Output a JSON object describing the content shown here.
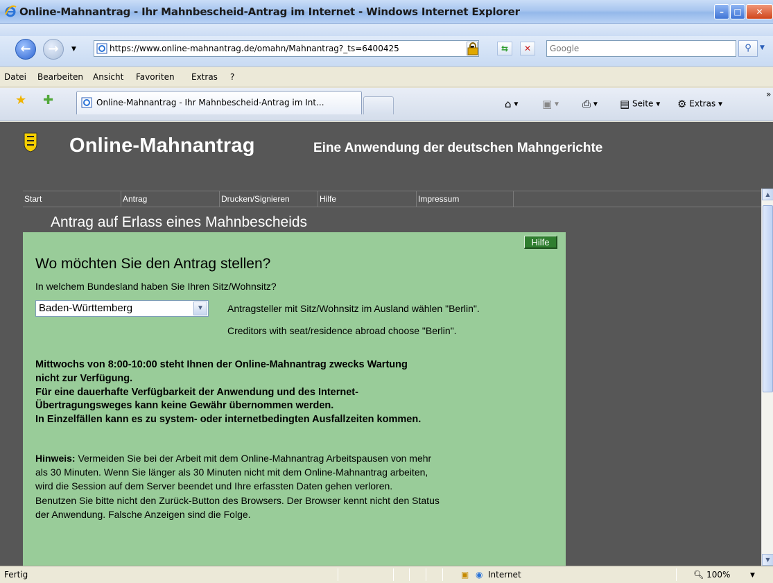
{
  "window": {
    "title": "Online-Mahnantrag - Ihr Mahnbescheid-Antrag im Internet - Windows Internet Explorer"
  },
  "address_bar": {
    "url": "https://www.online-mahnantrag.de/omahn/Mahnantrag?_ts=6400425",
    "search_placeholder": "Google"
  },
  "menu": {
    "items": [
      "Datei",
      "Bearbeiten",
      "Ansicht",
      "Favoriten",
      "Extras",
      "?"
    ]
  },
  "tabbar": {
    "tab_title": "Online-Mahnantrag - Ihr Mahnbescheid-Antrag im Int...",
    "page_label": "Seite",
    "extras_label": "Extras"
  },
  "site": {
    "brand": "Online-Mahnantrag",
    "slogan": "Eine Anwendung der deutschen Mahngerichte",
    "nav": [
      "Start",
      "Antrag",
      "Drucken/Signieren",
      "Hilfe",
      "Impressum"
    ],
    "page_heading": "Antrag auf Erlass eines Mahnbescheids"
  },
  "form": {
    "help_label": "Hilfe",
    "heading": "Wo möchten Sie den Antrag stellen?",
    "question": "In welchem Bundesland haben Sie Ihren Sitz/Wohnsitz?",
    "selected_state": "Baden-Württemberg",
    "note_de": "Antragsteller mit Sitz/Wohnsitz im Ausland wählen \"Berlin\".",
    "note_en": "Creditors with seat/residence abroad choose \"Berlin\"."
  },
  "notices": {
    "maintenance_lines": [
      "Mittwochs von 8:00-10:00 steht Ihnen der Online-Mahnantrag zwecks Wartung",
      "nicht zur Verfügung.",
      "Für eine dauerhafte Verfügbarkeit der Anwendung und des Internet-",
      "Übertragungsweges kann keine Gewähr übernommen werden.",
      "In Einzelfällen kann es zu system- oder internetbedingten Ausfallzeiten kommen."
    ],
    "hint_label": "Hinweis:",
    "hint_first": " Vermeiden Sie bei der Arbeit mit dem Online-Mahnantrag Arbeitspausen von mehr",
    "hint_lines": [
      "als 30 Minuten. Wenn Sie länger als 30 Minuten nicht mit dem Online-Mahnantrag arbeiten,",
      "wird die Session auf dem Server beendet und Ihre erfassten Daten gehen verloren.",
      "Benutzen Sie bitte nicht den Zurück-Button des Browsers. Der Browser kennt nicht den Status",
      "der Anwendung. Falsche Anzeigen sind die Folge."
    ]
  },
  "statusbar": {
    "status": "Fertig",
    "zone": "Internet",
    "zoom": "100%"
  },
  "colors": {
    "page_background": "#575757",
    "panel_green": "#99cc99",
    "help_button": "#2f7e2f"
  }
}
